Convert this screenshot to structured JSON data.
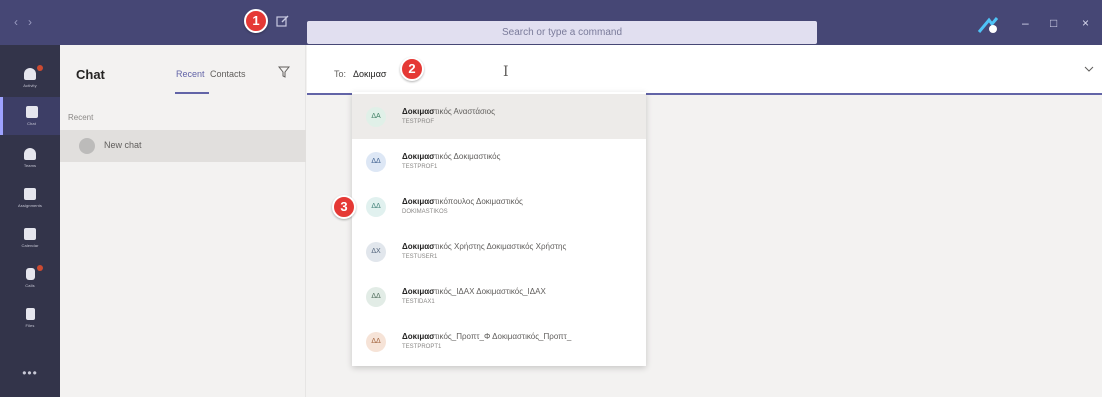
{
  "titlebar": {
    "back_icon": "back-arrow-icon",
    "forward_icon": "forward-arrow-icon",
    "search_placeholder": "Search or type a command",
    "minimize": "–",
    "maximize": "□",
    "close": "×"
  },
  "rail": {
    "items": [
      {
        "label": "Activity",
        "icon": "bell-icon",
        "badge": true
      },
      {
        "label": "Chat",
        "icon": "chat-icon",
        "active": true
      },
      {
        "label": "Teams",
        "icon": "teams-icon"
      },
      {
        "label": "Assignments",
        "icon": "assignments-icon"
      },
      {
        "label": "Calendar",
        "icon": "calendar-icon"
      },
      {
        "label": "Calls",
        "icon": "phone-icon",
        "badge": true
      },
      {
        "label": "Files",
        "icon": "files-icon"
      }
    ],
    "more": "•••"
  },
  "chatlist": {
    "title": "Chat",
    "tabs": [
      "Recent",
      "Contacts"
    ],
    "section": "Recent",
    "new_chat": "New chat"
  },
  "main": {
    "to_label": "To:",
    "to_value": "Δοκιμασ"
  },
  "suggestions": [
    {
      "initials": "ΔΑ",
      "match": "Δοκιμασ",
      "rest": "τικός Αναστάσιος",
      "sub": "TESTPROF",
      "bg": "#e0f0e8",
      "fg": "#3f7f63"
    },
    {
      "initials": "ΔΔ",
      "match": "Δοκιμασ",
      "rest": "τικός Δοκιμαστικός",
      "sub": "TESTPROF1",
      "bg": "#dde7f5",
      "fg": "#3d5f8f"
    },
    {
      "initials": "ΔΔ",
      "match": "Δοκιμασ",
      "rest": "τικόπουλος Δοκιμαστικός",
      "sub": "DOKIMASTIKOS",
      "bg": "#e1f1ef",
      "fg": "#3f7f76"
    },
    {
      "initials": "ΔΧ",
      "match": "Δοκιμασ",
      "rest": "τικός Χρήστης Δοκιμαστικός Χρήστης",
      "sub": "TESTUSER1",
      "bg": "#e1e6ec",
      "fg": "#51627a"
    },
    {
      "initials": "ΔΔ",
      "match": "Δοκιμασ",
      "rest": "τικός_ΙΔΑΧ Δοκιμαστικός_ΙΔΑΧ",
      "sub": "TESTIDAX1",
      "bg": "#e2ece6",
      "fg": "#4e6b5a"
    },
    {
      "initials": "ΔΔ",
      "match": "Δοκιμασ",
      "rest": "τικός_Προπτ_Φ Δοκιμαστικός_Προπτ_",
      "sub": "TESTPROPT1",
      "bg": "#f6e3d7",
      "fg": "#a0603a"
    }
  ],
  "markers": [
    "1",
    "2",
    "3"
  ],
  "colors": {
    "titlebar": "#464775",
    "rail": "#33344a",
    "accent": "#6264a7",
    "marker": "#e53935"
  }
}
